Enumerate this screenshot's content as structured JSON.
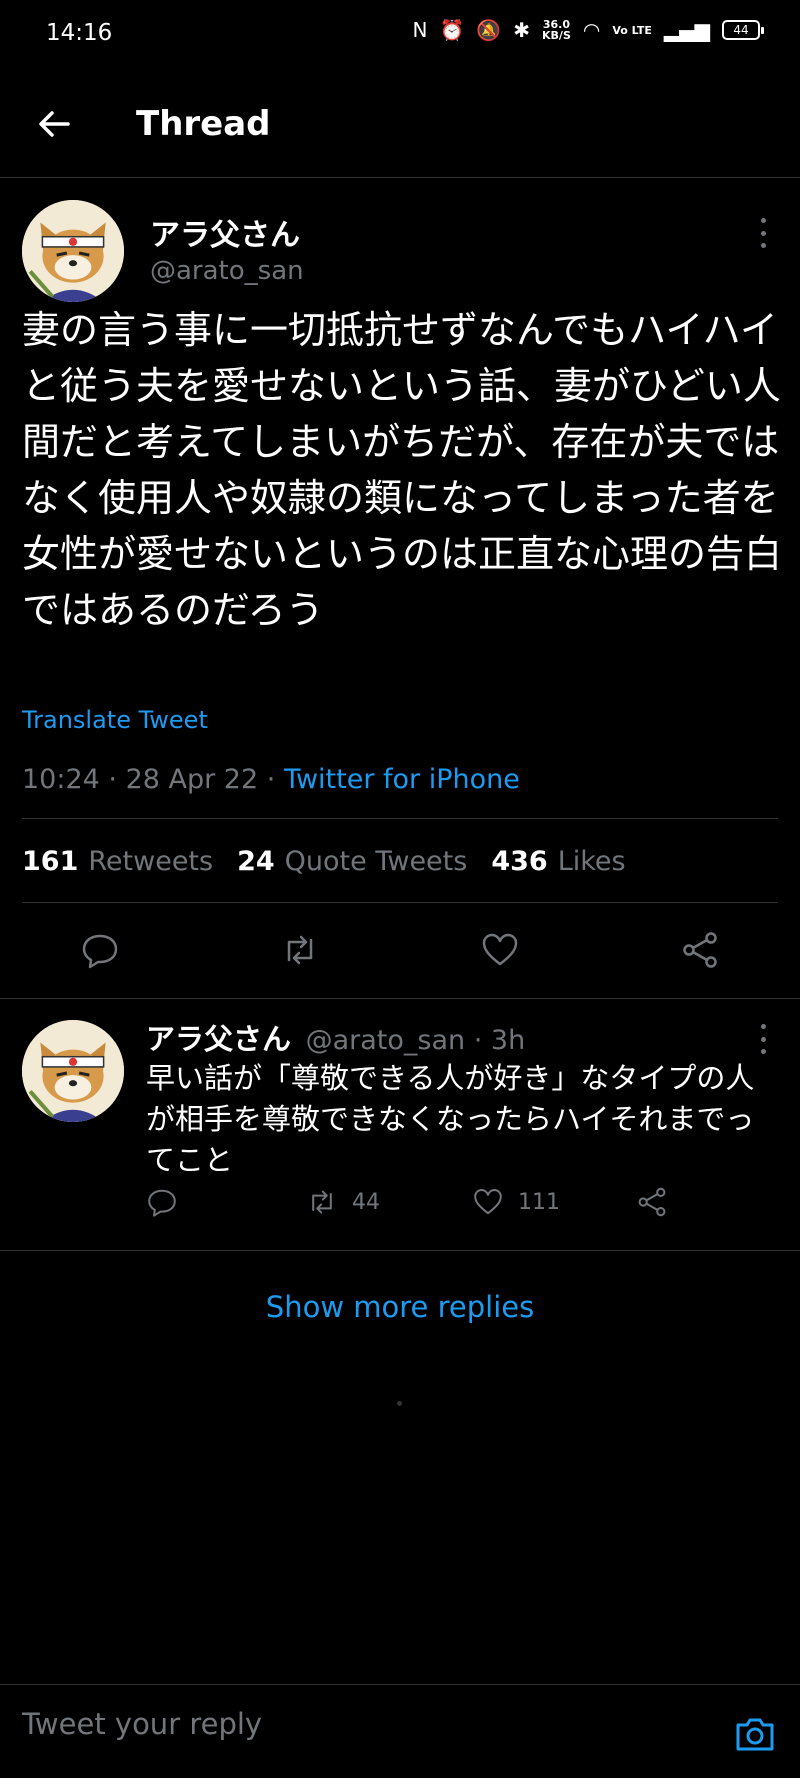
{
  "status_bar": {
    "time": "14:16",
    "net_speed": "36.0",
    "net_unit": "KB/S",
    "volte": "Vo LTE",
    "battery": "44"
  },
  "header": {
    "title": "Thread"
  },
  "main_tweet": {
    "author_name": "アラ父さん",
    "author_handle": "@arato_san",
    "text": "妻の言う事に一切抵抗せずなんでもハイハイと従う夫を愛せないという話、妻がひどい人間だと考えてしまいがちだが、存在が夫ではなく使用人や奴隷の類になってしまった者を女性が愛せないというのは正直な心理の告白ではあるのだろう",
    "translate_label": "Translate Tweet",
    "time": "10:24",
    "date": "28 Apr 22",
    "client": "Twitter for iPhone",
    "stats": {
      "retweets_count": "161",
      "retweets_label": "Retweets",
      "quotes_count": "24",
      "quotes_label": "Quote Tweets",
      "likes_count": "436",
      "likes_label": "Likes"
    }
  },
  "reply": {
    "author_name": "アラ父さん",
    "author_handle": "@arato_san",
    "age": "3h",
    "text": "早い話が「尊敬できる人が好き」なタイプの人が相手を尊敬できなくなったらハイそれまでってこと",
    "retweets": "44",
    "likes": "111"
  },
  "show_more_label": "Show more replies",
  "reply_bar": {
    "placeholder": "Tweet your reply"
  },
  "colors": {
    "accent": "#1d9bf0",
    "muted": "#71767b",
    "divider": "#2f3336",
    "background": "#000000"
  }
}
